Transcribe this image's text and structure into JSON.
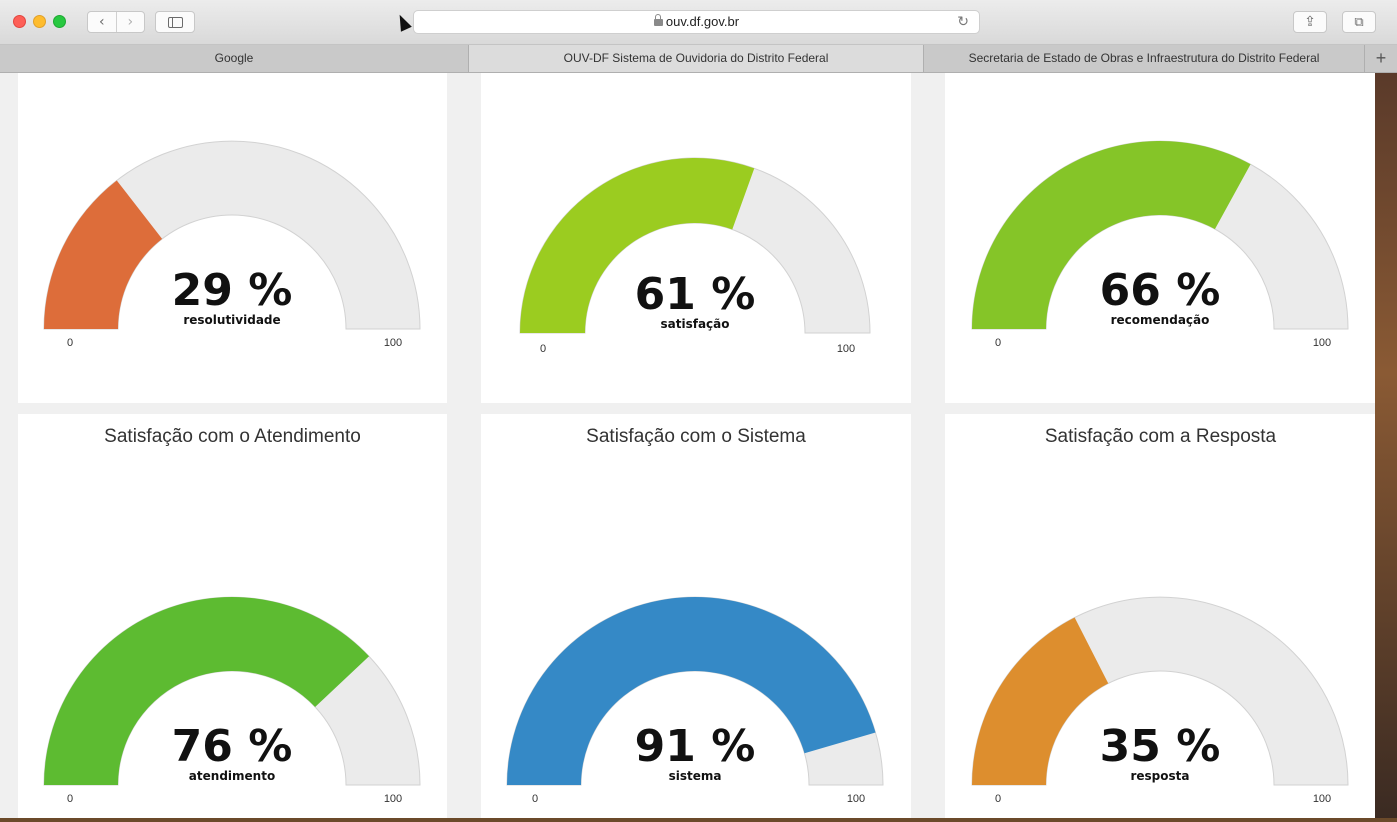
{
  "browser": {
    "url": "ouv.df.gov.br",
    "back_icon": "chevron-left-icon",
    "forward_icon": "chevron-right-icon",
    "tabs": [
      {
        "label": "Google"
      },
      {
        "label": "OUV-DF Sistema de Ouvidoria do Distrito Federal"
      },
      {
        "label": "Secretaria de Estado de Obras e Infraestrutura do Distrito Federal"
      }
    ],
    "new_tab_label": "+"
  },
  "gauges": [
    {
      "title": "",
      "value": 29,
      "value_text": "29 %",
      "label": "resolutividade",
      "min": "0",
      "max": "100",
      "color": "#dd6d3a"
    },
    {
      "title": "",
      "value": 61,
      "value_text": "61 %",
      "label": "satisfação",
      "min": "0",
      "max": "100",
      "color": "#9bcc20"
    },
    {
      "title": "",
      "value": 66,
      "value_text": "66 %",
      "label": "recomendação",
      "min": "0",
      "max": "100",
      "color": "#85c528"
    },
    {
      "title": "Satisfação com o Atendimento",
      "value": 76,
      "value_text": "76 %",
      "label": "atendimento",
      "min": "0",
      "max": "100",
      "color": "#5dbb31"
    },
    {
      "title": "Satisfação com o Sistema",
      "value": 91,
      "value_text": "91 %",
      "label": "sistema",
      "min": "0",
      "max": "100",
      "color": "#3589c6"
    },
    {
      "title": "Satisfação com a Resposta",
      "value": 35,
      "value_text": "35 %",
      "label": "resposta",
      "min": "0",
      "max": "100",
      "color": "#dd8e2e"
    }
  ]
}
